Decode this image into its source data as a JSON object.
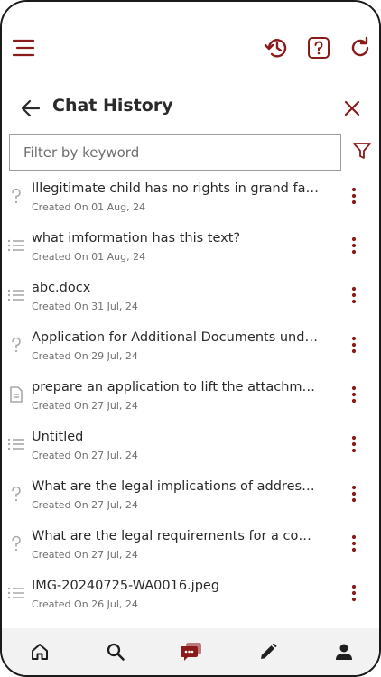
{
  "colors": {
    "accent": "#8b1a1a",
    "icon_grey": "#a8a8a8",
    "text": "#2a2a2a"
  },
  "topbar": {
    "menu_icon": "hamburger-icon",
    "history_icon": "history-icon",
    "help_icon": "help-icon",
    "refresh_icon": "refresh-icon"
  },
  "panel": {
    "title": "Chat History",
    "back_icon": "arrow-left-icon",
    "close_icon": "close-icon",
    "filter_icon": "filter-icon",
    "search_placeholder": "Filter by keyword",
    "search_value": ""
  },
  "items": [
    {
      "icon": "question-icon",
      "title": "Illegitimate child has no rights in grand fathe...",
      "date": "Created On 01 Aug, 24"
    },
    {
      "icon": "list-icon",
      "title": "what imformation has this text?",
      "date": "Created On 01 Aug, 24"
    },
    {
      "icon": "list-icon",
      "title": "abc.docx",
      "date": "Created On 31 Jul, 24"
    },
    {
      "icon": "question-icon",
      "title": "Application for Additional Documents under ...",
      "date": "Created On 29 Jul, 24"
    },
    {
      "icon": "document-icon",
      "title": "prepare an application to lift the attachmenti...",
      "date": "Created On 27 Jul, 24"
    },
    {
      "icon": "list-icon",
      "title": "Untitled",
      "date": "Created On 27 Jul, 24"
    },
    {
      "icon": "question-icon",
      "title": "What are the legal implications of addressing...",
      "date": "Created On 27 Jul, 24"
    },
    {
      "icon": "question-icon",
      "title": "What are the legal requirements for a compa...",
      "date": "Created On 27 Jul, 24"
    },
    {
      "icon": "list-icon",
      "title": "IMG-20240725-WA0016.jpeg",
      "date": "Created On 26 Jul, 24"
    }
  ],
  "bottomnav": [
    {
      "name": "home",
      "icon": "home-icon",
      "active": false
    },
    {
      "name": "search",
      "icon": "search-icon",
      "active": false
    },
    {
      "name": "chat",
      "icon": "chat-icon",
      "active": true
    },
    {
      "name": "edit",
      "icon": "pencil-icon",
      "active": false
    },
    {
      "name": "profile",
      "icon": "person-icon",
      "active": false
    }
  ]
}
